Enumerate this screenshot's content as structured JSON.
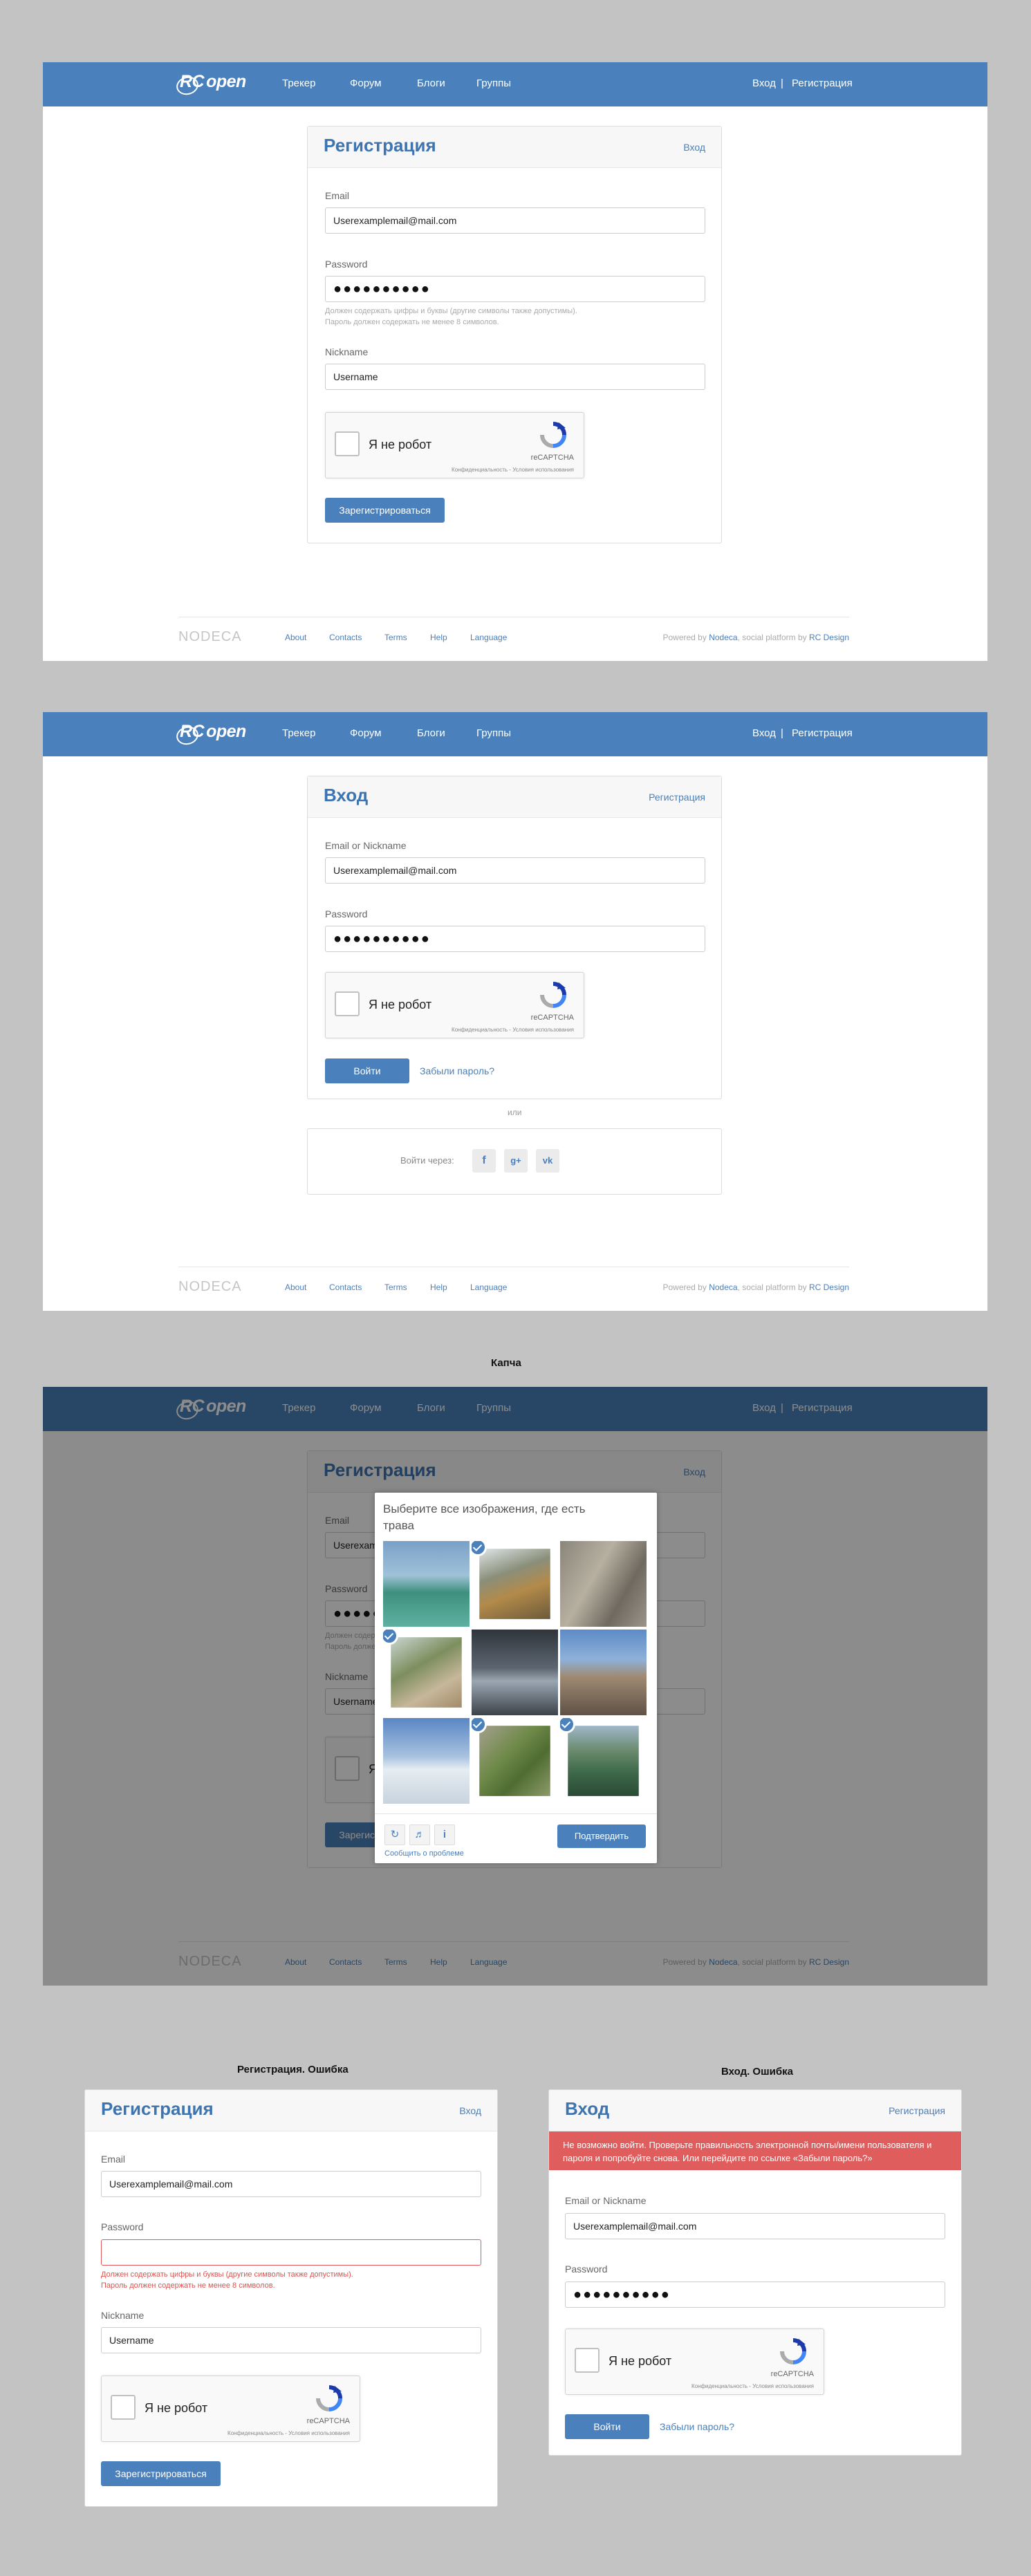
{
  "nav": {
    "logo_rc": "RC",
    "logo_open": "open",
    "items": [
      "Трекер",
      "Форум",
      "Блоги",
      "Группы"
    ],
    "login": "Вход",
    "separator": "|",
    "register": "Регистрация"
  },
  "footer": {
    "logo": "NODECA",
    "items": [
      "About",
      "Contacts",
      "Terms",
      "Help",
      "Language"
    ],
    "powered_prefix": "Powered by",
    "powered_nodeca": "Nodeca",
    "powered_mid": ", social platform by",
    "powered_rc": "RC Design"
  },
  "captcha": {
    "label": "Я не робот",
    "brand": "reCAPTCHA",
    "foot": "Конфиденциальность - Условия использования"
  },
  "register": {
    "title": "Регистрация",
    "login_link": "Вход",
    "email_label": "Email",
    "email_value": "Userexamplemail@mail.com",
    "password_label": "Password",
    "password_value": "●●●●●●●●●●",
    "password_hint_1": "Должен содержать цифры и буквы (другие символы также допустимы).",
    "password_hint_2": "Пароль должен содержать не менее 8 символов.",
    "nickname_label": "Nickname",
    "nickname_value": "Username",
    "submit": "Зарегистрироваться"
  },
  "login": {
    "title": "Вход",
    "register_link": "Регистрация",
    "login_label": "Email or Nickname",
    "login_value": "Userexamplemail@mail.com",
    "password_label": "Password",
    "password_value": "●●●●●●●●●●",
    "submit": "Войти",
    "forgot": "Забыли пароль?",
    "or": "или",
    "via": "Войти через:",
    "social": [
      "f",
      "g+",
      "vk"
    ]
  },
  "captcha_section": {
    "caption": "Капча",
    "prompt": "Выберите все изображения, где есть трава",
    "verify": "Подтвердить",
    "report": "Сообщить о проблеме",
    "icons": [
      "reload-icon",
      "audio-icon",
      "info-icon"
    ]
  },
  "register_error": {
    "caption": "Регистрация. Ошибка",
    "error_1": "Должен содержать цифры и буквы (другие символы также допустимы).",
    "error_2": "Пароль должен содержать не менее 8 символов."
  },
  "login_error": {
    "caption": "Вход. Ошибка",
    "message": "Не возможно войти. Проверьте правильность электронной почты/имени пользователя и пароля и попробуйте снова. Или перейдите по ссылке «Забыли пароль?»"
  },
  "colors": {
    "brand": "#4a80bb",
    "error": "#e05d5d",
    "background": "#c3c3c3"
  }
}
